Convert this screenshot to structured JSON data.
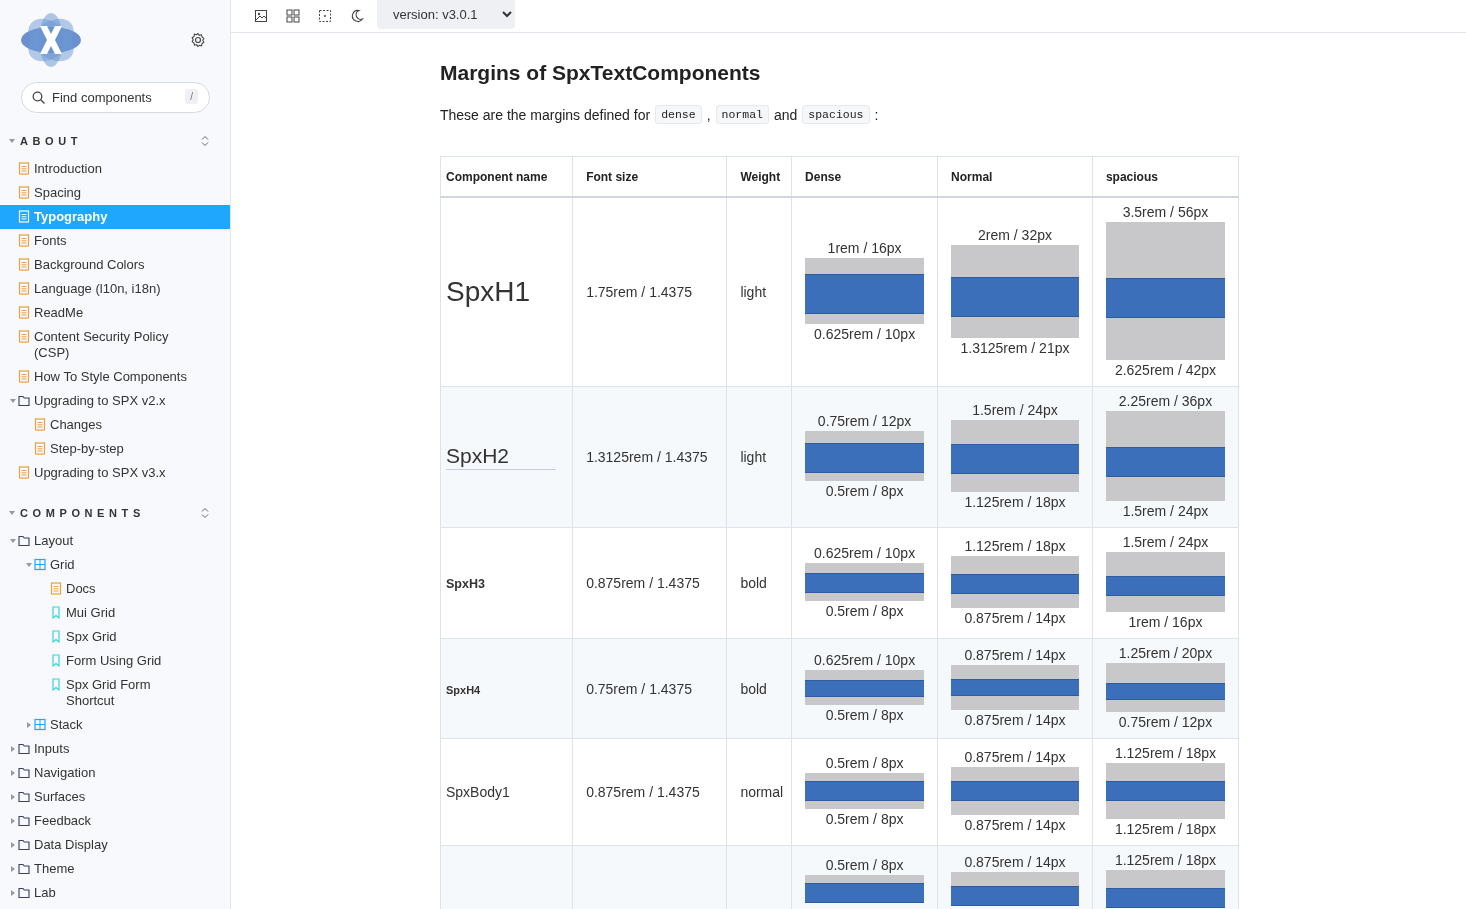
{
  "sidebar": {
    "search": {
      "placeholder": "Find components",
      "shortcut": "/"
    },
    "sections": [
      {
        "title": "ABOUT",
        "expanded": true,
        "items": [
          {
            "label": "Introduction",
            "kind": "doc",
            "selected": false
          },
          {
            "label": "Spacing",
            "kind": "doc",
            "selected": false
          },
          {
            "label": "Typography",
            "kind": "doc",
            "selected": true
          },
          {
            "label": "Fonts",
            "kind": "doc",
            "selected": false
          },
          {
            "label": "Background Colors",
            "kind": "doc",
            "selected": false
          },
          {
            "label": "Language (l10n, i18n)",
            "kind": "doc",
            "selected": false
          },
          {
            "label": "ReadMe",
            "kind": "doc",
            "selected": false
          },
          {
            "label": "Content Security Policy (CSP)",
            "kind": "doc",
            "selected": false
          },
          {
            "label": "How To Style Components",
            "kind": "doc",
            "selected": false
          },
          {
            "label": "Upgrading to SPX v2.x",
            "kind": "folder",
            "selected": false,
            "expanded": true,
            "children": [
              {
                "label": "Changes",
                "kind": "doc",
                "selected": false
              },
              {
                "label": "Step-by-step",
                "kind": "doc",
                "selected": false
              }
            ]
          },
          {
            "label": "Upgrading to SPX v3.x",
            "kind": "doc",
            "selected": false
          }
        ]
      },
      {
        "title": "COMPONENTS",
        "expanded": true,
        "items": [
          {
            "label": "Layout",
            "kind": "folder",
            "selected": false,
            "expanded": true,
            "children": [
              {
                "label": "Grid",
                "kind": "grid",
                "selected": false,
                "expanded": true,
                "children": [
                  {
                    "label": "Docs",
                    "kind": "doc",
                    "selected": false
                  },
                  {
                    "label": "Mui Grid",
                    "kind": "story",
                    "selected": false
                  },
                  {
                    "label": "Spx Grid",
                    "kind": "story",
                    "selected": false
                  },
                  {
                    "label": "Form Using Grid",
                    "kind": "story",
                    "selected": false
                  },
                  {
                    "label": "Spx Grid Form Shortcut",
                    "kind": "story",
                    "selected": false
                  }
                ]
              },
              {
                "label": "Stack",
                "kind": "grid",
                "selected": false,
                "expanded": false
              }
            ]
          },
          {
            "label": "Inputs",
            "kind": "folder",
            "selected": false,
            "expanded": false
          },
          {
            "label": "Navigation",
            "kind": "folder",
            "selected": false,
            "expanded": false
          },
          {
            "label": "Surfaces",
            "kind": "folder",
            "selected": false,
            "expanded": false
          },
          {
            "label": "Feedback",
            "kind": "folder",
            "selected": false,
            "expanded": false
          },
          {
            "label": "Data Display",
            "kind": "folder",
            "selected": false,
            "expanded": false
          },
          {
            "label": "Theme",
            "kind": "folder",
            "selected": false,
            "expanded": false
          },
          {
            "label": "Lab",
            "kind": "folder",
            "selected": false,
            "expanded": false
          }
        ]
      }
    ]
  },
  "toolbar": {
    "tools": [
      {
        "kind": "image"
      },
      {
        "kind": "grid"
      },
      {
        "kind": "frame"
      },
      {
        "kind": "moon"
      }
    ],
    "version": "version: v3.0.1"
  },
  "content": {
    "title": "Margins of SpxTextComponents",
    "intro": [
      {
        "kind": "text",
        "text": "These are the margins defined for"
      },
      {
        "kind": "code",
        "text": "dense"
      },
      {
        "kind": "text",
        "text": ","
      },
      {
        "kind": "code",
        "text": "normal"
      },
      {
        "kind": "text",
        "text": "and"
      },
      {
        "kind": "code",
        "text": "spacious"
      },
      {
        "kind": "text",
        "text": ":"
      }
    ],
    "table": {
      "columns": [
        "Component name",
        "Font size",
        "Weight",
        "Dense",
        "Normal",
        "spacious"
      ],
      "rows": [
        {
          "kind": "h1",
          "name": "SpxH1",
          "font_size": "1.75rem / 1.4375",
          "weight": "light",
          "margins": [
            {
              "top": "1rem / 16px",
              "bottom": "0.625rem / 10px"
            },
            {
              "top": "2rem / 32px",
              "bottom": "1.3125rem / 21px"
            },
            {
              "top": "3.5rem / 56px",
              "bottom": "2.625rem / 42px"
            }
          ]
        },
        {
          "kind": "h2",
          "name": "SpxH2",
          "font_size": "1.3125rem / 1.4375",
          "weight": "light",
          "margins": [
            {
              "top": "0.75rem / 12px",
              "bottom": "0.5rem / 8px"
            },
            {
              "top": "1.5rem / 24px",
              "bottom": "1.125rem / 18px"
            },
            {
              "top": "2.25rem / 36px",
              "bottom": "1.5rem / 24px"
            }
          ]
        },
        {
          "kind": "h3",
          "name": "SpxH3",
          "font_size": "0.875rem / 1.4375",
          "weight": "bold",
          "margins": [
            {
              "top": "0.625rem / 10px",
              "bottom": "0.5rem / 8px"
            },
            {
              "top": "1.125rem / 18px",
              "bottom": "0.875rem / 14px"
            },
            {
              "top": "1.5rem / 24px",
              "bottom": "1rem / 16px"
            }
          ]
        },
        {
          "kind": "h4",
          "name": "SpxH4",
          "font_size": "0.75rem / 1.4375",
          "weight": "bold",
          "margins": [
            {
              "top": "0.625rem / 10px",
              "bottom": "0.5rem / 8px"
            },
            {
              "top": "0.875rem / 14px",
              "bottom": "0.875rem / 14px"
            },
            {
              "top": "1.25rem / 20px",
              "bottom": "0.75rem / 12px"
            }
          ]
        },
        {
          "kind": "body1",
          "name": "SpxBody1",
          "font_size": "0.875rem / 1.4375",
          "weight": "normal",
          "margins": [
            {
              "top": "0.5rem / 8px",
              "bottom": "0.5rem / 8px"
            },
            {
              "top": "0.875rem / 14px",
              "bottom": "0.875rem / 14px"
            },
            {
              "top": "1.125rem / 18px",
              "bottom": "1.125rem / 18px"
            }
          ]
        },
        {
          "margins": [
            {
              "top": "0.5rem / 8px"
            },
            {
              "top": "0.875rem / 14px"
            },
            {
              "top": "1.125rem / 18px"
            }
          ]
        }
      ]
    }
  }
}
